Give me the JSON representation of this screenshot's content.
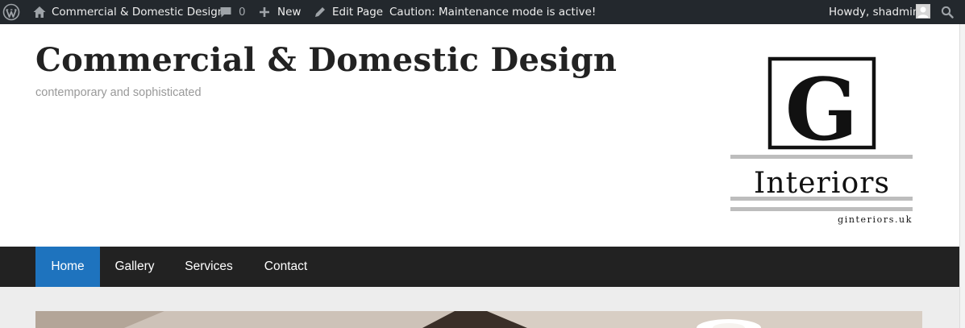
{
  "adminbar": {
    "wp_icon": "wordpress-logo-icon",
    "site_name": "Commercial & Domestic Design",
    "comments_count": "0",
    "new_label": "New",
    "edit_label": "Edit Page",
    "caution": "Caution: Maintenance mode is active!",
    "howdy": "Howdy, shadmin",
    "search_icon": "search-icon",
    "background": "#23282d"
  },
  "header": {
    "title": "Commercial & Domestic Design",
    "description": "contemporary and sophisticated",
    "logo": {
      "letter": "G",
      "word": "Interiors",
      "url": "ginteriors.uk"
    }
  },
  "nav": {
    "items": [
      {
        "label": "Home",
        "active": true
      },
      {
        "label": "Gallery",
        "active": false
      },
      {
        "label": "Services",
        "active": false
      },
      {
        "label": "Contact",
        "active": false
      }
    ],
    "accent": "#1e73be",
    "background": "#222222"
  }
}
